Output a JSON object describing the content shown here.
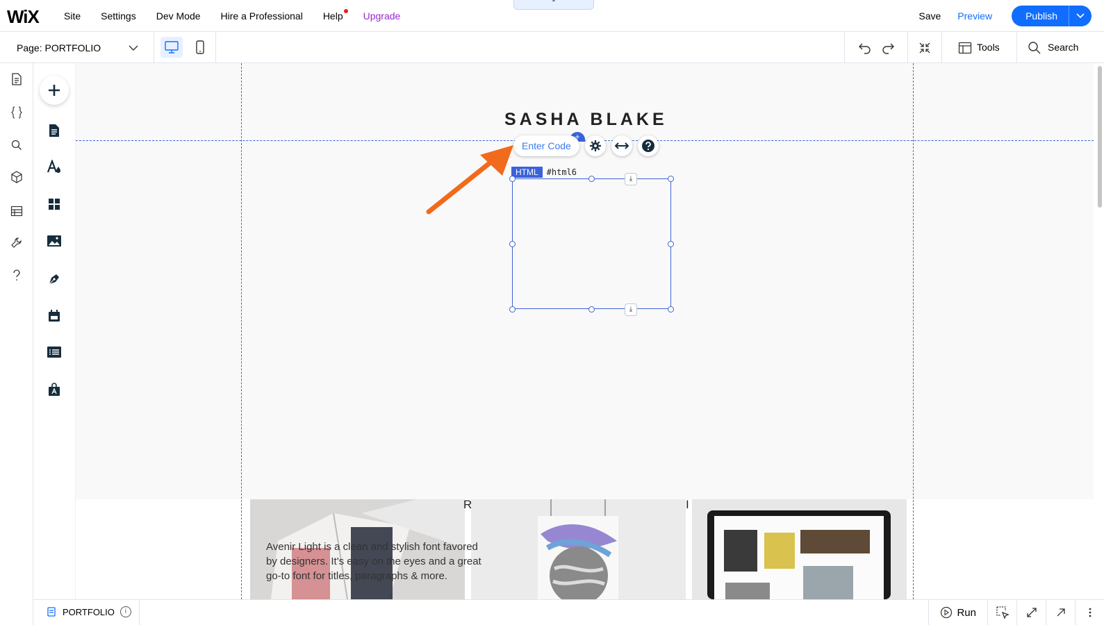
{
  "topbar": {
    "logo": "WiX",
    "nav": [
      "Site",
      "Settings",
      "Dev Mode",
      "Hire a Professional",
      "Help",
      "Upgrade"
    ],
    "collapse_glyph": "⌃",
    "save": "Save",
    "preview": "Preview",
    "publish": "Publish",
    "publish_caret": "⌄"
  },
  "toolbar": {
    "page_label": "Page: PORTFOLIO",
    "tools": "Tools",
    "search": "Search"
  },
  "canvas": {
    "site_title": "SASHA BLAKE",
    "enter_code": "Enter Code",
    "plus": "+",
    "html_badge": "HTML",
    "html_id": "#html6",
    "anchor_glyph": "⤓",
    "gallery_text": "Avenir Light is a clean and stylish font favored by designers. It's easy on the eyes and a great go-to font for titles, paragraphs & more.",
    "letter_r": "R",
    "letter_i": "I"
  },
  "bottombar": {
    "page_name": "PORTFOLIO",
    "info": "i",
    "run": "Run"
  },
  "colors": {
    "accent": "#116dff",
    "upgrade": "#9a27d5",
    "selection": "#3b62d8",
    "arrow": "#f26a1b"
  }
}
